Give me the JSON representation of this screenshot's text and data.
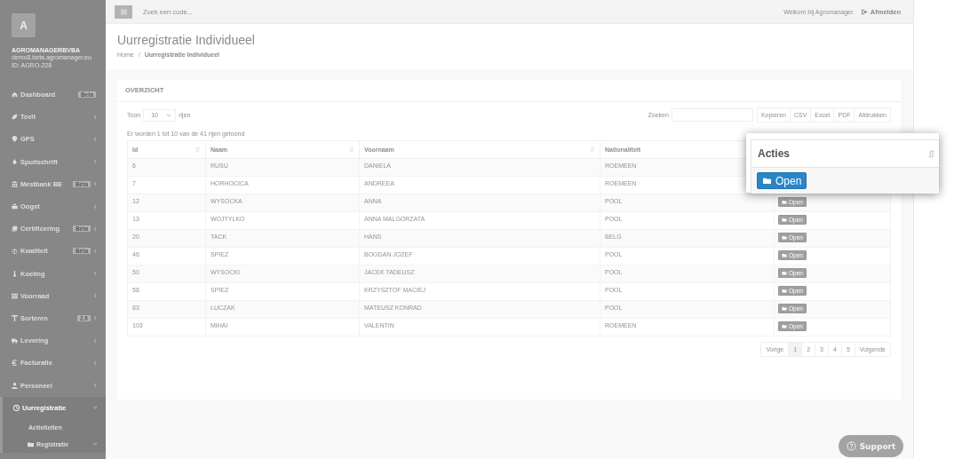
{
  "sidebar": {
    "avatar": "A",
    "company": "AGROMANAGERBVBA",
    "domain": "demo8.beta.agromanager.eu",
    "account_id": "ID: AGRO-228",
    "items": [
      {
        "label": "Dashboard",
        "badge": "Beta"
      },
      {
        "label": "Teelt",
        "expanded": false
      },
      {
        "label": "GPS",
        "expanded": false
      },
      {
        "label": "Spuitschrift",
        "expanded": false
      },
      {
        "label": "Mestbank BE",
        "badge": "Bèta",
        "expanded": false
      },
      {
        "label": "Oogst",
        "expanded": false
      },
      {
        "label": "Certificering",
        "badge": "Bèta",
        "expanded": false
      },
      {
        "label": "Kwaliteit",
        "badge": "Bèta",
        "expanded": false
      },
      {
        "label": "Koeling",
        "expanded": false
      },
      {
        "label": "Voorraad",
        "expanded": false
      },
      {
        "label": "Sorteren",
        "badge": "2.0",
        "expanded": false
      },
      {
        "label": "Levering",
        "expanded": false
      },
      {
        "label": "Facturatie",
        "expanded": false
      },
      {
        "label": "Personeel",
        "expanded": false
      },
      {
        "label": "Uurregistratie",
        "expanded": true,
        "selected": true,
        "children": [
          {
            "label": "Activiteiten"
          },
          {
            "label": "Registratie",
            "expanded": true
          }
        ]
      }
    ]
  },
  "topbar": {
    "search_placeholder": "Zoek een code...",
    "welcome": "Welkom bij Agromanager.",
    "logout": "Afmelden"
  },
  "page": {
    "title": "Uurregistratie Individueel",
    "breadcrumb": [
      "Home",
      "Uurregistratie Individueel"
    ],
    "breadcrumb_separator": "/"
  },
  "panel": {
    "title": "OVERZICHT",
    "length_prefix": "Toon",
    "length_value": "10",
    "length_suffix": "rijen",
    "search_label": "Zoeken",
    "export_buttons": [
      "Kopieren",
      "CSV",
      "Excel",
      "PDF",
      "Afdrukken"
    ],
    "info": "Er worden 1 tot 10 van de 41 rijen getoond",
    "columns": [
      {
        "label": "Id",
        "sort_icon": true
      },
      {
        "label": "Naam",
        "sort_icon": true
      },
      {
        "label": "Voornaam",
        "sort_icon": true
      },
      {
        "label": "Nationaliteit"
      }
    ],
    "rows": [
      {
        "cells": [
          "6",
          "RUSU",
          "DANIELA",
          "ROEMEEN"
        ]
      },
      {
        "cells": [
          "7",
          "HORHOCICA",
          "ANDREEA",
          "ROEMEEN"
        ]
      },
      {
        "cells": [
          "12",
          "WYSOCKA",
          "ANNA",
          "POOL"
        ],
        "action": "Open"
      },
      {
        "cells": [
          "13",
          "WOJTYLKO",
          "ANNA MALGORZATA",
          "POOL"
        ],
        "action": "Open"
      },
      {
        "cells": [
          "20",
          "TACK",
          "HANS",
          "BELG"
        ],
        "action": "Open"
      },
      {
        "cells": [
          "46",
          "SPIEZ",
          "BOGDAN JOZEF",
          "POOL"
        ],
        "action": "Open"
      },
      {
        "cells": [
          "50",
          "WYSOCKI",
          "JACEK TADEUSZ",
          "POOL"
        ],
        "action": "Open"
      },
      {
        "cells": [
          "58",
          "SPIEZ",
          "KRZYSZTOF MACIEJ",
          "POOL"
        ],
        "action": "Open"
      },
      {
        "cells": [
          "83",
          "LUCZAK",
          "MATEUSZ KONRAD",
          "POOL"
        ],
        "action": "Open"
      },
      {
        "cells": [
          "103",
          "MIHAI",
          "VALENTIN",
          "ROEMEEN"
        ],
        "action": "Open"
      }
    ],
    "pagination": [
      {
        "label": "Vorige",
        "selected": false
      },
      {
        "label": "1",
        "selected": true
      },
      {
        "label": "2",
        "selected": false
      },
      {
        "label": "3",
        "selected": false
      },
      {
        "label": "4",
        "selected": false
      },
      {
        "label": "5",
        "selected": false
      },
      {
        "label": "Volgende",
        "selected": false
      }
    ]
  },
  "callout": {
    "column": "Acties",
    "button": "Open"
  },
  "support": "Support"
}
